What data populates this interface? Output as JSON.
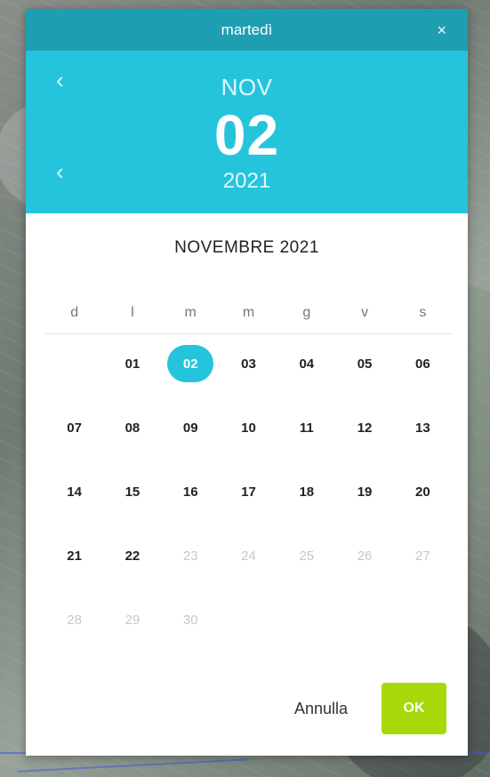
{
  "dialog": {
    "title": "martedì",
    "close_icon": "×"
  },
  "header": {
    "prev_month_icon": "‹",
    "month_short": "NOV",
    "day": "02",
    "prev_year_icon": "‹",
    "year": "2021"
  },
  "calendar": {
    "title": "NOVEMBRE 2021",
    "weekdays": [
      "d",
      "l",
      "m",
      "m",
      "g",
      "v",
      "s"
    ],
    "days": [
      {
        "label": "",
        "state": "empty"
      },
      {
        "label": "01",
        "state": "enabled"
      },
      {
        "label": "02",
        "state": "selected"
      },
      {
        "label": "03",
        "state": "enabled"
      },
      {
        "label": "04",
        "state": "enabled"
      },
      {
        "label": "05",
        "state": "enabled"
      },
      {
        "label": "06",
        "state": "enabled"
      },
      {
        "label": "07",
        "state": "enabled"
      },
      {
        "label": "08",
        "state": "enabled"
      },
      {
        "label": "09",
        "state": "enabled"
      },
      {
        "label": "10",
        "state": "enabled"
      },
      {
        "label": "11",
        "state": "enabled"
      },
      {
        "label": "12",
        "state": "enabled"
      },
      {
        "label": "13",
        "state": "enabled"
      },
      {
        "label": "14",
        "state": "enabled"
      },
      {
        "label": "15",
        "state": "enabled"
      },
      {
        "label": "16",
        "state": "enabled"
      },
      {
        "label": "17",
        "state": "enabled"
      },
      {
        "label": "18",
        "state": "enabled"
      },
      {
        "label": "19",
        "state": "enabled"
      },
      {
        "label": "20",
        "state": "enabled"
      },
      {
        "label": "21",
        "state": "enabled"
      },
      {
        "label": "22",
        "state": "enabled"
      },
      {
        "label": "23",
        "state": "disabled"
      },
      {
        "label": "24",
        "state": "disabled"
      },
      {
        "label": "25",
        "state": "disabled"
      },
      {
        "label": "26",
        "state": "disabled"
      },
      {
        "label": "27",
        "state": "disabled"
      },
      {
        "label": "28",
        "state": "disabled"
      },
      {
        "label": "29",
        "state": "disabled"
      },
      {
        "label": "30",
        "state": "disabled"
      }
    ]
  },
  "footer": {
    "cancel_label": "Annulla",
    "ok_label": "OK"
  },
  "colors": {
    "title_bar": "#1e9fb1",
    "header": "#25c4dc",
    "selected": "#25c4dc",
    "ok_button": "#a7d90a"
  }
}
